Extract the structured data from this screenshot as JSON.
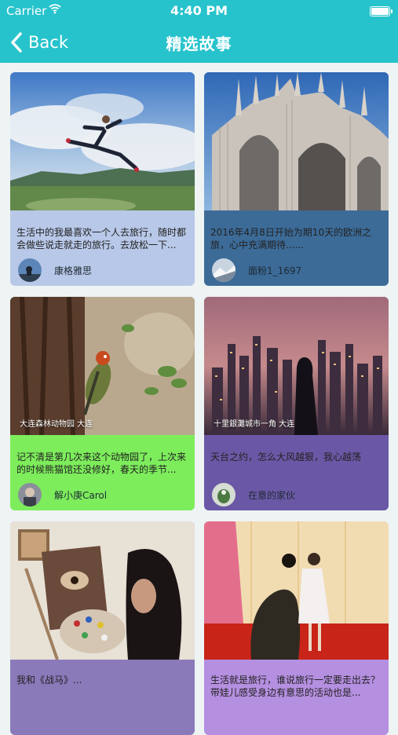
{
  "status_bar": {
    "carrier": "Carrier",
    "time": "4:40 PM"
  },
  "nav": {
    "back_label": "Back",
    "title": "精选故事"
  },
  "colors": {
    "accent": "#27c3cc"
  },
  "stories": [
    {
      "caption": "生活中的我最喜欢一个人去旅行，随时都会做些说走就走的旅行。去放松一下...",
      "author": "康格雅思",
      "card_color": "#b8c8e8"
    },
    {
      "caption": "2016年4月8日开始为期10天的欧洲之旅，心中充满期待......",
      "author": "面粉1_1697",
      "card_color": "#3c6b98"
    },
    {
      "caption": "记不清是第几次来这个动物园了，上次来的时候熊猫馆还没修好，春天的季节...",
      "author": "解小庚Carol",
      "card_color": "#7ded5c",
      "photo_text": "大连森林动物园 大连"
    },
    {
      "caption": "天台之约，怎么大风越狠，我心越荡",
      "author": "在意的家伙",
      "card_color": "#6a58a6",
      "photo_text": "十里銀灘城市一角 大连"
    },
    {
      "caption": "我和《战马》...",
      "author": "",
      "card_color": "#8a7aba"
    },
    {
      "caption": "生活就是旅行，谁说旅行一定要走出去？带娃儿感受身边有意思的活动也是...",
      "author": "",
      "card_color": "#b58fe0"
    }
  ]
}
